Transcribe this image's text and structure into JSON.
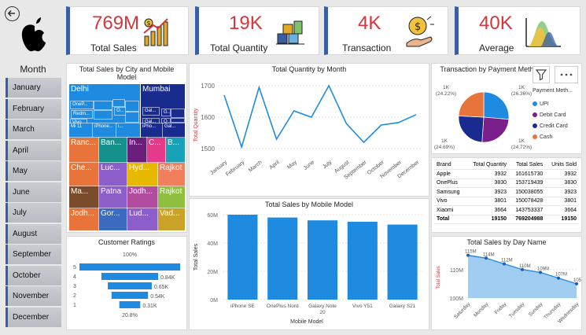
{
  "kpis": [
    {
      "value": "769M",
      "label": "Total Sales"
    },
    {
      "value": "19K",
      "label": "Total Quantity"
    },
    {
      "value": "4K",
      "label": "Transaction"
    },
    {
      "value": "40K",
      "label": "Average"
    }
  ],
  "month_slicer": {
    "title": "Month",
    "items": [
      "January",
      "February",
      "March",
      "April",
      "May",
      "June",
      "July",
      "August",
      "September",
      "October",
      "November",
      "December"
    ]
  },
  "treemap": {
    "title": "Total Sales by City and Mobile Model",
    "labels": [
      "Delhi",
      "Mumbai",
      "OneP...",
      "Redm...",
      "Vivo",
      "Gal...",
      "Mi 11",
      "iPhone...",
      "Gal...",
      "Ranc...",
      "Ban...",
      "In...",
      "C...",
      "B...",
      "Che...",
      "Luc...",
      "Hyd...",
      "Rajkot",
      "Ma...",
      "Patna",
      "Jodh...",
      "Gor...",
      "Lud...",
      "Vad...",
      "O...",
      "G...",
      "O...",
      "i...",
      "iPho...",
      "iPh...",
      "Gal..."
    ]
  },
  "quantity_chart": {
    "title": "Total Quantity by Month"
  },
  "pie": {
    "title": "Transaction by Payment Method",
    "legend_title": "Payment Meth...",
    "labels": [
      "1K\n(24.22%)",
      "1K\n(26.36%)",
      "1K\n(24.69%)",
      "1K\n(24.72%)"
    ]
  },
  "brand_table": {
    "headers": [
      "Brand",
      "Total Quantity",
      "Total Sales",
      "Units Sold"
    ],
    "rows": [
      [
        "Apple",
        "3932",
        "161615730",
        "3932"
      ],
      [
        "OnePlus",
        "3830",
        "153719439",
        "3830"
      ],
      [
        "Samsung",
        "3923",
        "150038055",
        "3923"
      ],
      [
        "Vivo",
        "3801",
        "150078428",
        "3801"
      ],
      [
        "Xiaomi",
        "3664",
        "143753337",
        "3664"
      ]
    ],
    "total": [
      "Total",
      "19150",
      "769204988",
      "19150"
    ]
  },
  "ratings": {
    "title": "Customer Ratings",
    "top_label": "100%",
    "bottom_label": "20.8%",
    "levels": [
      "5",
      "4",
      "3",
      "2",
      "1"
    ],
    "value_labels": [
      "",
      "0.84K",
      "0.65K",
      "0.54K",
      "0.31K"
    ]
  },
  "sales_model_chart": {
    "title": "Total Sales by Mobile Model"
  },
  "day_chart": {
    "title": "Total Sales by Day Name"
  },
  "chart_data": [
    {
      "type": "treemap",
      "title": "Total Sales by City and Mobile Model",
      "cities": [
        "Delhi",
        "Mumbai",
        "Ranchi",
        "Bangalore",
        "Indore",
        "Chennai",
        "Lucknow",
        "Hyderabad",
        "Rajkot",
        "Madurai",
        "Patna",
        "Jodhpur",
        "Gorakhpur",
        "Ludhiana",
        "Vadodara"
      ]
    },
    {
      "type": "line",
      "title": "Total Quantity by Month",
      "ylabel": "Total Quantity",
      "categories": [
        "January",
        "February",
        "March",
        "April",
        "May",
        "June",
        "July",
        "August",
        "September",
        "October",
        "November",
        "December"
      ],
      "values": [
        1670,
        1505,
        1695,
        1530,
        1620,
        1600,
        1700,
        1580,
        1520,
        1575,
        1583,
        1608
      ],
      "ylim": [
        1480,
        1720
      ],
      "yticks": [
        1500,
        1600,
        1700
      ],
      "ytick_labels": [
        "1500",
        "1600",
        "1700"
      ],
      "color": "#1f8be0"
    },
    {
      "type": "pie",
      "title": "Transaction by Payment Method",
      "legend": [
        "UPI",
        "Debit Card",
        "Credit Card",
        "Cash"
      ],
      "colors": [
        "#1f8be0",
        "#7b1f8a",
        "#1a2b8f",
        "#e8743b"
      ],
      "values": [
        26.36,
        24.72,
        24.69,
        24.22
      ]
    },
    {
      "type": "funnel",
      "title": "Customer Ratings",
      "categories": [
        "5",
        "4",
        "3",
        "2",
        "1"
      ],
      "values": [
        1490,
        840,
        650,
        540,
        310
      ],
      "color": "#1f8be0"
    },
    {
      "type": "bar",
      "title": "Total Sales by Mobile Model",
      "xlabel": "Mobile Model",
      "ylabel": "Total Sales",
      "categories": [
        "iPhone SE",
        "OnePlus Nord",
        "Galaxy Note 20",
        "Vivo Y51",
        "Galaxy S21"
      ],
      "values": [
        60,
        58,
        56,
        55,
        53
      ],
      "ylim": [
        0,
        60
      ],
      "yticks": [
        0,
        20,
        40,
        60
      ],
      "ytick_labels": [
        "0M",
        "20M",
        "40M",
        "60M"
      ],
      "color": "#1f8be0"
    },
    {
      "type": "area",
      "title": "Total Sales by Day Name",
      "ylabel": "Total Sales",
      "categories": [
        "Saturday",
        "Monday",
        "Friday",
        "Tuesday",
        "Sunday",
        "Thursday",
        "Wednesday"
      ],
      "values": [
        115,
        114,
        112,
        110,
        109,
        107,
        105
      ],
      "data_labels": [
        "115M",
        "114M",
        "112M",
        "110M",
        "109M",
        "107M",
        "105M"
      ],
      "ylim": [
        100,
        116
      ],
      "yticks": [
        100,
        110
      ],
      "ytick_labels": [
        "100M",
        "110M"
      ],
      "color": "#1f8be0"
    }
  ]
}
